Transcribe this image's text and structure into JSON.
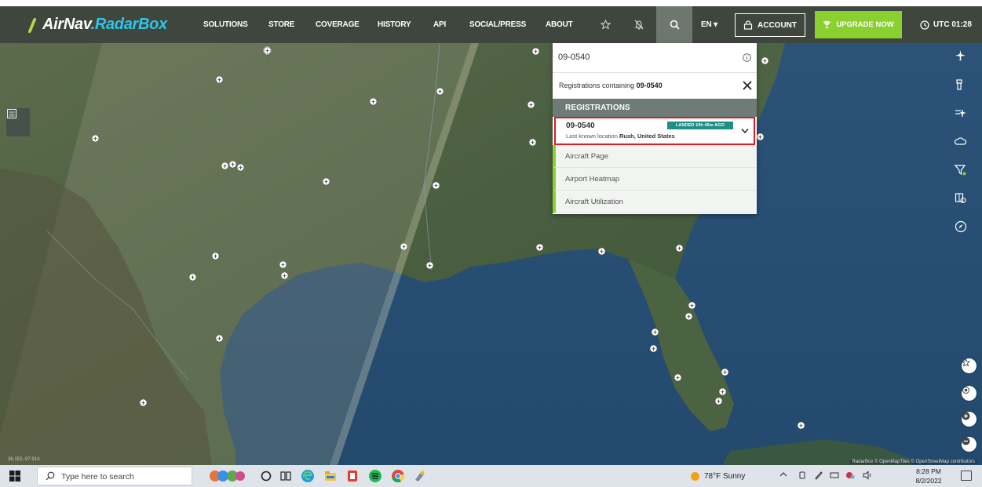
{
  "nav": {
    "logo_air": "AirNav",
    "logo_dot": ".",
    "logo_radar": "RadarBox",
    "items": [
      "SOLUTIONS",
      "STORE",
      "COVERAGE",
      "HISTORY",
      "API",
      "SOCIAL/PRESS",
      "ABOUT"
    ],
    "language": "EN ▾",
    "account_label": "ACCOUNT",
    "upgrade_label": "UPGRADE NOW",
    "utc_label": "UTC 01:28",
    "icons": [
      "star-icon",
      "bell-off-icon",
      "search-icon"
    ]
  },
  "search_panel": {
    "query": "09-0540",
    "containing_prefix": "Registrations containing ",
    "containing_term": "09-0540",
    "section_title": "REGISTRATIONS",
    "result": {
      "registration": "09-0540",
      "status_badge": "LANDED 10h 45m AGO",
      "location_prefix": "Last known location ",
      "location": "Rush, United States"
    },
    "actions": [
      "Aircraft Page",
      "Airport Heatmap",
      "Aircraft Utilization"
    ]
  },
  "map": {
    "attribution": "RadarBox © OpenMapTiles © OpenStreetMap contributors",
    "coords": "36.152,-97.914"
  },
  "right_rail": {
    "icons": [
      "aircraft-filter-icon",
      "tower-icon",
      "flights-icon",
      "weather-icon",
      "filter-icon",
      "layers-icon",
      "compass-icon"
    ],
    "round_buttons": [
      "favorite-icon",
      "locate-icon",
      "zoom-in-icon",
      "zoom-out-icon"
    ]
  },
  "taskbar": {
    "search_placeholder": "Type here to search",
    "weather": "78°F  Sunny",
    "time": "8:28 PM",
    "date": "8/2/2022"
  },
  "colors": {
    "nav_bg": "#3f463d",
    "brand_green": "#8ad02f",
    "brand_blue": "#2fc4e8",
    "badge_teal": "#1f8e86",
    "highlight_red": "#e01a22"
  }
}
